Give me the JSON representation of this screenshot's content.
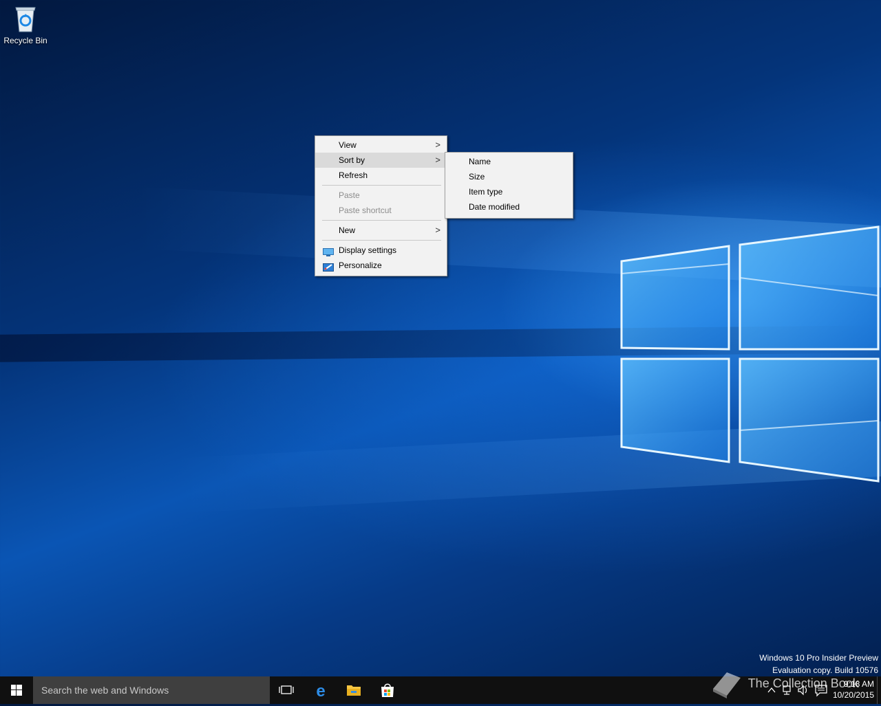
{
  "desktop": {
    "icons": [
      {
        "label": "Recycle Bin",
        "icon": "recycle-bin-icon"
      }
    ]
  },
  "context_menu": {
    "items": {
      "view": "View",
      "sort_by": "Sort by",
      "refresh": "Refresh",
      "paste": "Paste",
      "paste_shortcut": "Paste shortcut",
      "new": "New",
      "display_settings": "Display settings",
      "personalize": "Personalize"
    },
    "submenu_arrow": ">"
  },
  "sort_submenu": {
    "items": [
      "Name",
      "Size",
      "Item type",
      "Date modified"
    ]
  },
  "watermark": {
    "line1": "Windows 10 Pro Insider Preview",
    "line2": "Evaluation copy. Build 10576"
  },
  "overlay_watermark": "The Collection Book",
  "taskbar": {
    "search_placeholder": "Search the web and Windows",
    "pinned": [
      "task-view-icon",
      "edge-icon",
      "file-explorer-icon",
      "store-icon"
    ],
    "clock": {
      "time": "9:18 AM",
      "date": "10/20/2015"
    },
    "tray_icons": [
      "chevron-up-icon",
      "network-icon",
      "volume-icon",
      "action-center-icon"
    ]
  },
  "colors": {
    "taskbar": "#101010",
    "search_box": "#3f3f3f",
    "menu_bg": "#f2f2f2",
    "menu_hover": "#dadada",
    "disabled_text": "#8c8c8c",
    "accent_blue": "#0a55b4"
  }
}
